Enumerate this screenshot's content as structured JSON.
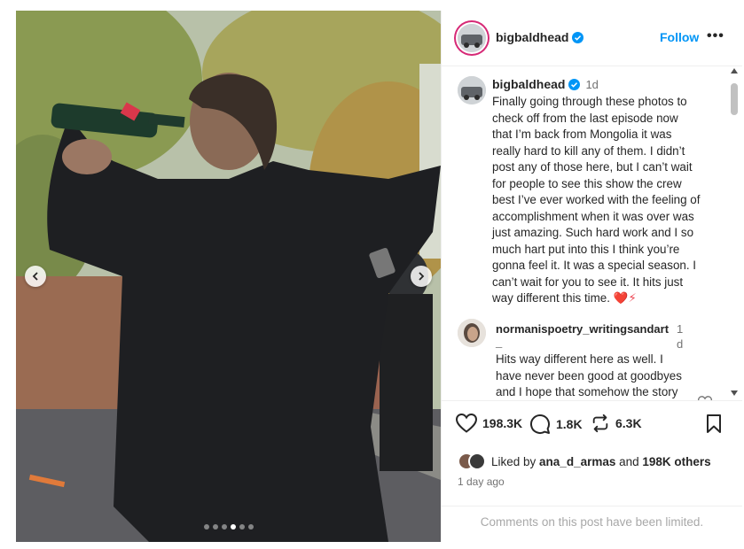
{
  "post": {
    "username": "bigbaldhead",
    "follow_label": "Follow",
    "more_label": "•••"
  },
  "caption": {
    "username": "bigbaldhead",
    "time": "1d",
    "lines": [
      "Finally going through these photos to",
      "check off from the last episode now",
      "that I’m back from Mongolia it was",
      "really hard to kill any of them. I didn’t",
      "post any of those here, but I can’t wait",
      "for people to see this show the crew",
      "best I’ve ever worked with the feeling of",
      "accomplishment when it was over was",
      "just amazing. Such hard work and I so",
      "much hart put into this I think you’re",
      "gonna feel it. It was a special season. I",
      "can’t wait for you to see it. It hits just",
      "way different this time."
    ],
    "emojis": "❤️⚡"
  },
  "comment": {
    "username_line1": "normanispoetry_writingsandart",
    "username_line2": "_",
    "time_line1": "1",
    "time_line2": "d",
    "lines": [
      "Hits way different here as well. I",
      "have never been good at goodbyes",
      "and I hope that somehow the story"
    ]
  },
  "actions": {
    "likes": "198.3K",
    "comments": "1.8K",
    "reposts": "6.3K"
  },
  "liked_by": {
    "prefix": "Liked by ",
    "user": "ana_d_armas",
    "middle": " and ",
    "others": "198K others"
  },
  "timestamp": "1 day ago",
  "comments_limited": "Comments on this post have been limited.",
  "carousel": {
    "total": 6,
    "active_index": 3
  },
  "colors": {
    "accent": "#0095f6",
    "heart_red": "#ed4956",
    "verified_blue": "#0095f6"
  }
}
